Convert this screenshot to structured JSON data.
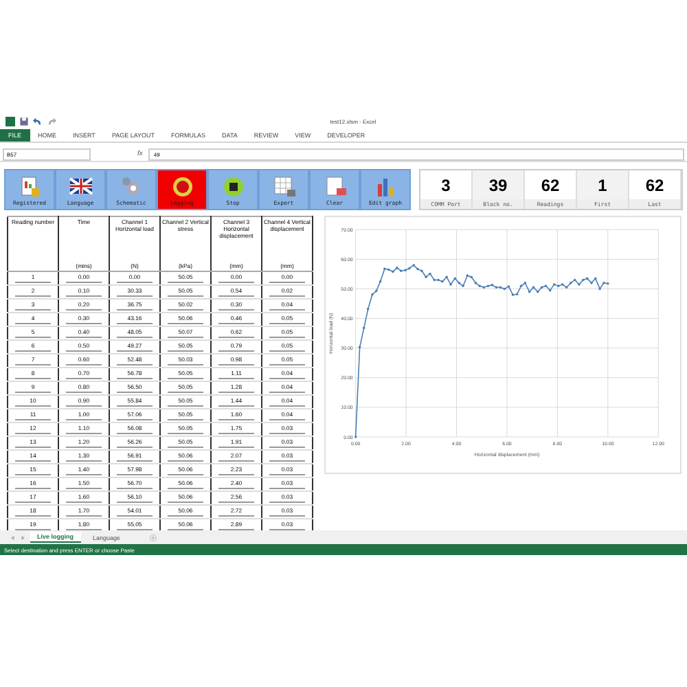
{
  "window": {
    "title": "test12.xlsm - Excel"
  },
  "ribbon_tabs": [
    {
      "label": "FILE",
      "selected": true
    },
    {
      "label": "HOME",
      "selected": false
    },
    {
      "label": "INSERT",
      "selected": false
    },
    {
      "label": "PAGE LAYOUT",
      "selected": false
    },
    {
      "label": "FORMULAS",
      "selected": false
    },
    {
      "label": "DATA",
      "selected": false
    },
    {
      "label": "REVIEW",
      "selected": false
    },
    {
      "label": "VIEW",
      "selected": false
    },
    {
      "label": "DEVELOPER",
      "selected": false
    }
  ],
  "formula_bar": {
    "name_box": "B57",
    "fx_label": "fx",
    "value": "49"
  },
  "buttons": [
    {
      "label": "Registered",
      "selected": false
    },
    {
      "label": "Language",
      "selected": false
    },
    {
      "label": "Schematic",
      "selected": false
    },
    {
      "label": "Logging",
      "selected": true
    },
    {
      "label": "Stop",
      "selected": false
    },
    {
      "label": "Export",
      "selected": false
    },
    {
      "label": "Clear",
      "selected": false
    },
    {
      "label": "Edit graph",
      "selected": false
    }
  ],
  "counters": [
    {
      "value": "3",
      "label": "COMM Port"
    },
    {
      "value": "39",
      "label": "Block no."
    },
    {
      "value": "62",
      "label": "Readings"
    },
    {
      "value": "1",
      "label": "First"
    },
    {
      "value": "62",
      "label": "Last"
    }
  ],
  "table": {
    "columns": [
      {
        "title": "Reading number"
      },
      {
        "title": "Time",
        "unit": "(mins)"
      },
      {
        "title": "Channel 1 Horizontal load",
        "unit": "(N)"
      },
      {
        "title": "Channel 2 Vertical stress",
        "unit": "(kPa)"
      },
      {
        "title": "Channel 3 Horizontal displacement",
        "unit": "(mm)"
      },
      {
        "title": "Channel 4 Vertical displacement",
        "unit": "(mm)"
      }
    ],
    "rows": [
      [
        "1",
        "0.00",
        "0.00",
        "50.05",
        "0.00",
        "0.00"
      ],
      [
        "2",
        "0.10",
        "30.33",
        "50.05",
        "0.54",
        "0.02"
      ],
      [
        "3",
        "0.20",
        "36.75",
        "50.02",
        "0.30",
        "0.04"
      ],
      [
        "4",
        "0.30",
        "43.16",
        "50.06",
        "0.46",
        "0.05"
      ],
      [
        "5",
        "0.40",
        "48.05",
        "50.07",
        "0.62",
        "0.05"
      ],
      [
        "6",
        "0.50",
        "49.27",
        "50.05",
        "0.79",
        "0.05"
      ],
      [
        "7",
        "0.60",
        "52.48",
        "50.03",
        "0.98",
        "0.05"
      ],
      [
        "8",
        "0.70",
        "56.78",
        "50.05",
        "1.11",
        "0.04"
      ],
      [
        "9",
        "0.80",
        "56.50",
        "50.05",
        "1.28",
        "0.04"
      ],
      [
        "10",
        "0.90",
        "55.84",
        "50.05",
        "1.44",
        "0.04"
      ],
      [
        "11",
        "1.00",
        "57.06",
        "50.05",
        "1.60",
        "0.04"
      ],
      [
        "12",
        "1.10",
        "56.08",
        "50.05",
        "1.75",
        "0.03"
      ],
      [
        "13",
        "1.20",
        "56.26",
        "50.05",
        "1.91",
        "0.03"
      ],
      [
        "14",
        "1.30",
        "56.91",
        "50.06",
        "2.07",
        "0.03"
      ],
      [
        "15",
        "1.40",
        "57.98",
        "50.06",
        "2.23",
        "0.03"
      ],
      [
        "16",
        "1.50",
        "56.70",
        "50.06",
        "2.40",
        "0.03"
      ],
      [
        "17",
        "1.60",
        "56.10",
        "50.06",
        "2.56",
        "0.03"
      ],
      [
        "18",
        "1.70",
        "54.01",
        "50.06",
        "2.72",
        "0.03"
      ],
      [
        "19",
        "1.80",
        "55.05",
        "50.06",
        "2.89",
        "0.03"
      ]
    ]
  },
  "chart": {
    "chart_data": {
      "type": "line",
      "xlabel": "Horizontal displacement (mm)",
      "ylabel": "Horizontal load (N)",
      "x": [
        0,
        0.16,
        0.33,
        0.49,
        0.66,
        0.82,
        0.98,
        1.15,
        1.31,
        1.48,
        1.64,
        1.8,
        1.97,
        2.13,
        2.3,
        2.46,
        2.62,
        2.79,
        2.95,
        3.12,
        3.28,
        3.44,
        3.61,
        3.77,
        3.94,
        4.1,
        4.26,
        4.43,
        4.59,
        4.76,
        4.92,
        5.08,
        5.25,
        5.41,
        5.58,
        5.74,
        5.9,
        6.07,
        6.23,
        6.4,
        6.56,
        6.72,
        6.89,
        7.05,
        7.22,
        7.38,
        7.54,
        7.71,
        7.87,
        8.04,
        8.2,
        8.36,
        8.53,
        8.69,
        8.86,
        9.02,
        9.18,
        9.35,
        9.51,
        9.68,
        9.84,
        10.0
      ],
      "grid": true,
      "series": [
        {
          "color": "#4a7fb5",
          "values": [
            0,
            30.3,
            36.8,
            43.2,
            48.1,
            49.3,
            52.5,
            56.8,
            56.5,
            55.8,
            57.1,
            56.1,
            56.3,
            56.9,
            58,
            56.7,
            56.1,
            54,
            55.1,
            53,
            53,
            52.5,
            54,
            51.5,
            53.5,
            52,
            51,
            54.5,
            54,
            52,
            51,
            50.5,
            51,
            51.3,
            50.5,
            50.5,
            50,
            50.8,
            48,
            48.2,
            51,
            52,
            49,
            50.5,
            49,
            50.5,
            51,
            49.5,
            51.5,
            51,
            51.5,
            50.5,
            52,
            53,
            51.5,
            53,
            53.5,
            52,
            53.5,
            50,
            52,
            51.8
          ]
        }
      ],
      "xlim": [
        0,
        12
      ],
      "ylim": [
        0,
        70
      ],
      "xticks": [
        {
          "value": 0,
          "label": "0.00"
        },
        {
          "value": 2,
          "label": "2.00"
        },
        {
          "value": 4,
          "label": "4.00"
        },
        {
          "value": 6,
          "label": "6.00"
        },
        {
          "value": 8,
          "label": "8.00"
        },
        {
          "value": 10,
          "label": "10.00"
        },
        {
          "value": 12,
          "label": "12.00"
        }
      ],
      "yticks": [
        {
          "value": 0,
          "label": "0.00"
        },
        {
          "value": 10,
          "label": "10.00"
        },
        {
          "value": 20,
          "label": "20.00"
        },
        {
          "value": 30,
          "label": "30.00"
        },
        {
          "value": 40,
          "label": "40.00"
        },
        {
          "value": 50,
          "label": "50.00"
        },
        {
          "value": 60,
          "label": "60.00"
        },
        {
          "value": 70,
          "label": "70.00"
        }
      ]
    }
  },
  "sheet_tabs": [
    {
      "label": "Live logging",
      "selected": true
    },
    {
      "label": "Language",
      "selected": false
    }
  ],
  "status_bar": "Select destination and press ENTER or choose Paste"
}
